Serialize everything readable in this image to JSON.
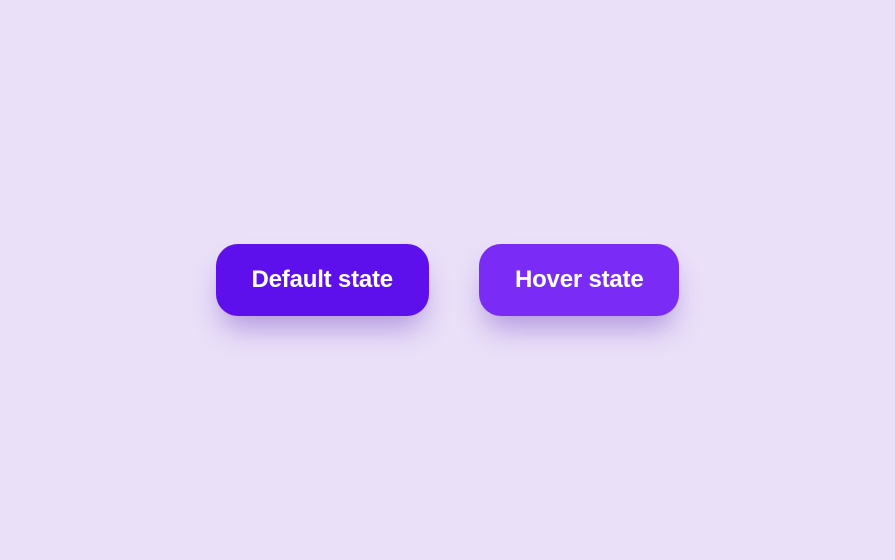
{
  "buttons": {
    "default": {
      "label": "Default state"
    },
    "hover": {
      "label": "Hover state"
    }
  },
  "colors": {
    "background": "#EAE0F8",
    "button_default": "#5E10EC",
    "button_hover": "#7A2BF5",
    "text": "#ffffff"
  }
}
